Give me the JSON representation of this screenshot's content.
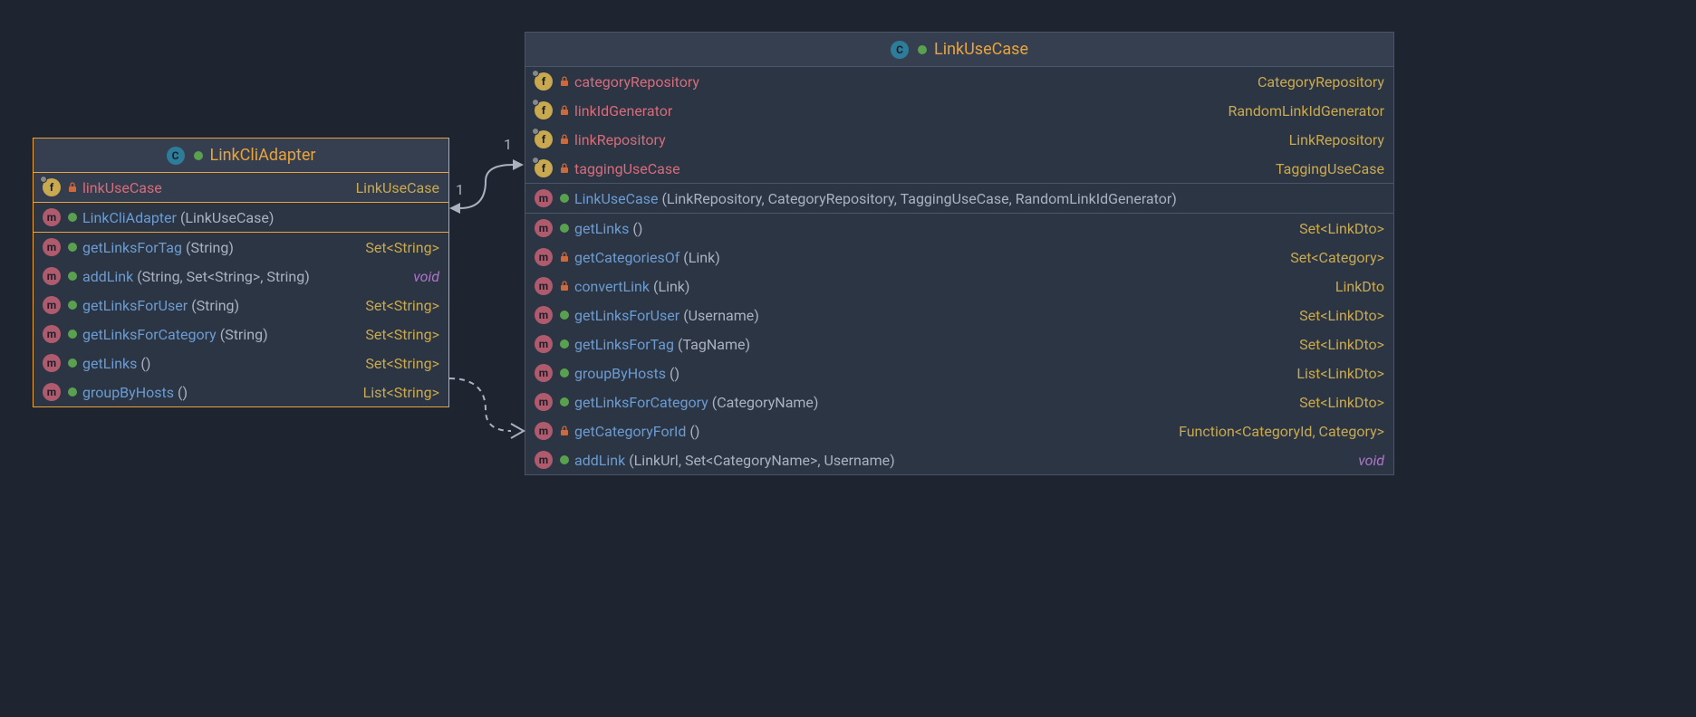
{
  "classes": {
    "left": {
      "name": "LinkCliAdapter",
      "fields": [
        {
          "name": "linkUseCase",
          "type": "LinkUseCase",
          "visibility": "private",
          "final": true
        }
      ],
      "constructors": [
        {
          "name": "LinkCliAdapter",
          "params": "(LinkUseCase)",
          "visibility": "public"
        }
      ],
      "methods": [
        {
          "name": "getLinksForTag",
          "params": "(String)",
          "ret": "Set<String>",
          "visibility": "public"
        },
        {
          "name": "addLink",
          "params": "(String, Set<String>, String)",
          "ret": "void",
          "visibility": "public"
        },
        {
          "name": "getLinksForUser",
          "params": "(String)",
          "ret": "Set<String>",
          "visibility": "public"
        },
        {
          "name": "getLinksForCategory",
          "params": "(String)",
          "ret": "Set<String>",
          "visibility": "public"
        },
        {
          "name": "getLinks",
          "params": "()",
          "ret": "Set<String>",
          "visibility": "public"
        },
        {
          "name": "groupByHosts",
          "params": "()",
          "ret": "List<String>",
          "visibility": "public"
        }
      ]
    },
    "right": {
      "name": "LinkUseCase",
      "fields": [
        {
          "name": "categoryRepository",
          "type": "CategoryRepository",
          "visibility": "private",
          "final": true
        },
        {
          "name": "linkIdGenerator",
          "type": "RandomLinkIdGenerator",
          "visibility": "private",
          "final": true
        },
        {
          "name": "linkRepository",
          "type": "LinkRepository",
          "visibility": "private",
          "final": true
        },
        {
          "name": "taggingUseCase",
          "type": "TaggingUseCase",
          "visibility": "private",
          "final": true
        }
      ],
      "constructors": [
        {
          "name": "LinkUseCase",
          "params": "(LinkRepository, CategoryRepository, TaggingUseCase, RandomLinkIdGenerator)",
          "visibility": "public"
        }
      ],
      "methods": [
        {
          "name": "getLinks",
          "params": "()",
          "ret": "Set<LinkDto>",
          "visibility": "public"
        },
        {
          "name": "getCategoriesOf",
          "params": "(Link)",
          "ret": "Set<Category>",
          "visibility": "private"
        },
        {
          "name": "convertLink",
          "params": "(Link)",
          "ret": "LinkDto",
          "visibility": "private"
        },
        {
          "name": "getLinksForUser",
          "params": "(Username)",
          "ret": "Set<LinkDto>",
          "visibility": "public"
        },
        {
          "name": "getLinksForTag",
          "params": "(TagName)",
          "ret": "Set<LinkDto>",
          "visibility": "public"
        },
        {
          "name": "groupByHosts",
          "params": "()",
          "ret": "List<LinkDto>",
          "visibility": "public"
        },
        {
          "name": "getLinksForCategory",
          "params": "(CategoryName)",
          "ret": "Set<LinkDto>",
          "visibility": "public"
        },
        {
          "name": "getCategoryForId",
          "params": "()",
          "ret": "Function<CategoryId, Category>",
          "visibility": "private"
        },
        {
          "name": "addLink",
          "params": "(LinkUrl, Set<CategoryName>, Username)",
          "ret": "void",
          "visibility": "public"
        }
      ]
    }
  },
  "relations": {
    "solid": {
      "from_mult": "1",
      "to_mult": "1"
    }
  }
}
